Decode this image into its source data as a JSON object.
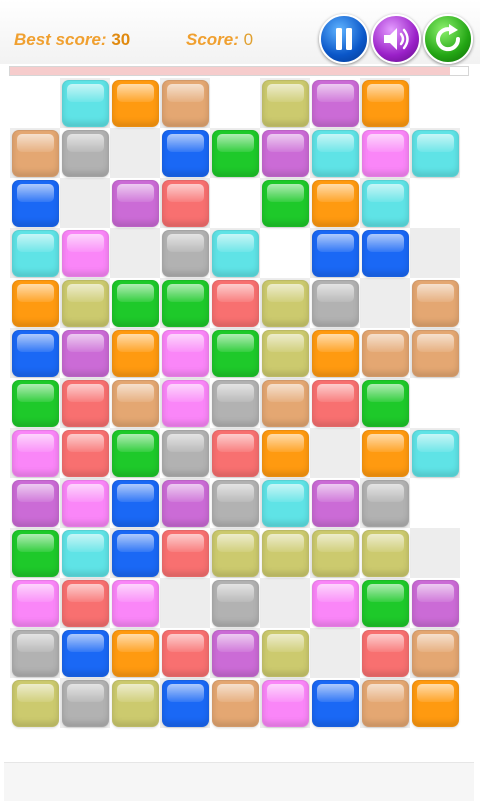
{
  "header": {
    "best_label": "Best score:",
    "best_value": "30",
    "score_label": "Score:",
    "score_value": "0",
    "pause_icon": "pause-icon",
    "sound_icon": "speaker-icon",
    "restart_icon": "restart-icon"
  },
  "progress": {
    "fraction": 0.96
  },
  "colors": {
    "c": "#5fe3e6",
    "o": "#ff9a10",
    "t": "#e4a772",
    "y": "#ccca6e",
    "v": "#cb6bd6",
    "s": "#b2b2b2",
    "b": "#1a68f5",
    "g": "#1ec92a",
    "p": "#fa86f8",
    "r": "#f87070"
  },
  "board": {
    "rows": [
      ".cot.yvo.",
      "ts.bgvcpc",
      "b.vr.goc.",
      "cp.sc.bb.",
      "oyggryswt",
      "bvopgyott",
      "grtpstrg.",
      "prgsro.oc",
      "vpbvscvs.",
      "gcbryyyy.",
      "prp.s.pgv",
      "sborvy.rt",
      "ysybtpbto"
    ]
  }
}
